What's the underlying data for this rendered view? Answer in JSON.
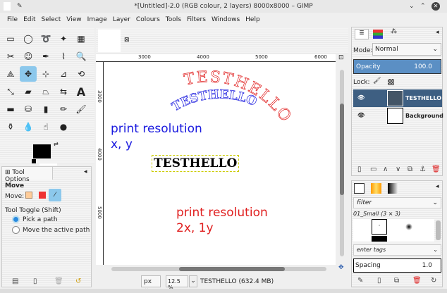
{
  "window": {
    "title": "*[Untitled]-2.0 (RGB colour, 2 layers) 8000x8000 – GIMP"
  },
  "menu": [
    "File",
    "Edit",
    "Select",
    "View",
    "Image",
    "Layer",
    "Colours",
    "Tools",
    "Filters",
    "Windows",
    "Help"
  ],
  "tool_options": {
    "tab": "Tool Options",
    "tool": "Move",
    "move_label": "Move:",
    "toggle_label": "Tool Toggle  (Shift)",
    "options": [
      "Pick a path",
      "Move the active path"
    ],
    "selected": 0
  },
  "rulers": {
    "h": [
      "3000",
      "4000",
      "5000",
      "6000"
    ],
    "v": [
      "3000",
      "4000",
      "5000"
    ]
  },
  "canvas": {
    "blue_text": [
      "print resolution",
      "x, y"
    ],
    "text_layer": "TESTHELLO",
    "red_text": [
      "print resolution",
      "2x, 1y"
    ],
    "curved_blue": "TESTHELLO",
    "curved_red": "TESTHELLO",
    "blue": "#1a1adf",
    "red": "#e02020"
  },
  "status": {
    "unit": "px",
    "zoom": "12.5 %",
    "info": "TESTHELLO (632.4 MB)"
  },
  "layers": {
    "mode_label": "Mode:",
    "mode": "Normal",
    "opacity_label": "Opacity",
    "opacity": "100.0",
    "lock_label": "Lock:",
    "items": [
      {
        "name": "TESTHELLO",
        "selected": true
      },
      {
        "name": "Background",
        "selected": false
      }
    ]
  },
  "brushes": {
    "filter": "filter",
    "brush_name": "01_Small (3 × 3)",
    "tags": "enter tags",
    "spacing_label": "Spacing",
    "spacing": "1.0"
  }
}
